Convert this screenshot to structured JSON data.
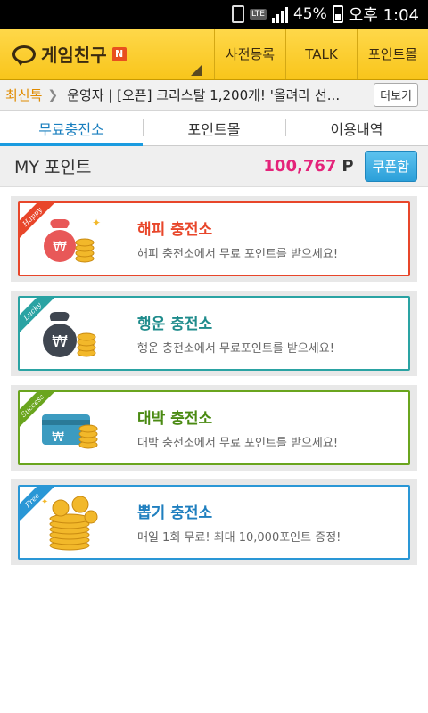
{
  "status_bar": {
    "battery": "45%",
    "time": "오후 1:04",
    "network": "LTE"
  },
  "app_bar": {
    "title": "게임친구",
    "badge": "N",
    "nav": [
      "사전등록",
      "TALK",
      "포인트몰"
    ]
  },
  "ticker": {
    "label": "최신톡",
    "text": "운영자 | [오픈] 크리스탈 1,200개! '올려라 선...",
    "more": "더보기"
  },
  "tabs": [
    {
      "label": "무료충전소",
      "active": true
    },
    {
      "label": "포인트몰",
      "active": false
    },
    {
      "label": "이용내역",
      "active": false
    }
  ],
  "my_point": {
    "label": "MY 포인트",
    "value": "100,767",
    "unit": "P",
    "coupon": "쿠폰함"
  },
  "stations": [
    {
      "title": "해피 충전소",
      "desc": "해피 충전소에서 무료 포인트를 받으세요!",
      "ribbon": "Happy",
      "color": "#e8462a",
      "icon": "money-bag-icon"
    },
    {
      "title": "행운 충전소",
      "desc": "행운 충전소에서 무료포인트를 받으세요!",
      "ribbon": "Lucky",
      "color": "#2aa3a3",
      "icon": "dark-money-bag-icon"
    },
    {
      "title": "대박 충전소",
      "desc": "대박 충전소에서 무료 포인트를 받으세요!",
      "ribbon": "Success",
      "color": "#6aa51e",
      "icon": "card-icon"
    },
    {
      "title": "뽑기 충전소",
      "desc": "매일 1회 무료! 최대 10,000포인트 증정!",
      "ribbon": "Free",
      "color": "#2a97d6",
      "icon": "gold-coins-icon"
    }
  ]
}
